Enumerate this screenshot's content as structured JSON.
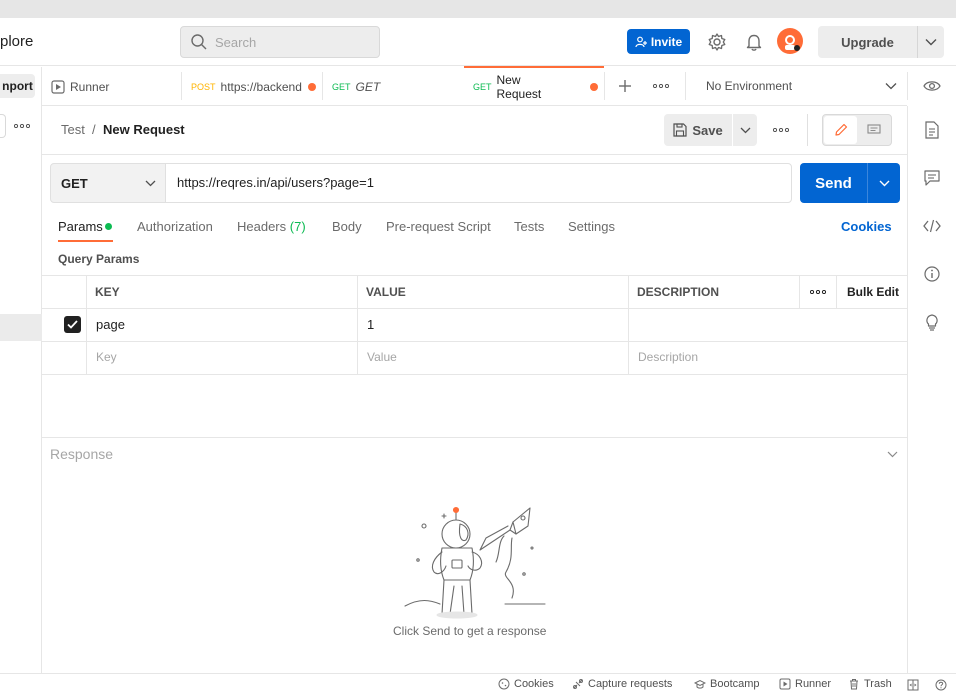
{
  "header": {
    "explore_label": "plore",
    "search_placeholder": "Search",
    "invite_label": "Invite",
    "upgrade_label": "Upgrade"
  },
  "sidebar": {
    "import_label": "nport"
  },
  "tabs": [
    {
      "label": "Runner"
    },
    {
      "method": "POST",
      "label": "https://backend"
    },
    {
      "method": "GET",
      "label": "GET"
    },
    {
      "method": "GET",
      "label": "New Request",
      "active": true
    },
    {
      "label": "No Environment"
    }
  ],
  "breadcrumb": {
    "collection": "Test",
    "separator": "/",
    "request": "New Request"
  },
  "toolbar": {
    "save_label": "Save"
  },
  "request": {
    "method": "GET",
    "url": "https://reqres.in/api/users?page=1",
    "send_label": "Send"
  },
  "request_tabs": {
    "params": "Params",
    "authorization": "Authorization",
    "headers": "Headers",
    "headers_count": "(7)",
    "body": "Body",
    "prerequest": "Pre-request Script",
    "tests": "Tests",
    "settings": "Settings",
    "cookies": "Cookies"
  },
  "query_params": {
    "title": "Query Params",
    "columns": [
      "KEY",
      "VALUE",
      "DESCRIPTION"
    ],
    "bulk_edit": "Bulk Edit",
    "rows": [
      {
        "checked": true,
        "key": "page",
        "value": "1",
        "description": ""
      }
    ],
    "placeholders": {
      "key": "Key",
      "value": "Value",
      "description": "Description"
    }
  },
  "response": {
    "title": "Response",
    "empty_message": "Click Send to get a response"
  },
  "statusbar": {
    "cookies": "Cookies",
    "capture": "Capture requests",
    "bootcamp": "Bootcamp",
    "runner": "Runner",
    "trash": "Trash"
  },
  "colors": {
    "accent": "#ff6c37",
    "primary": "#0265d2",
    "get_method": "#0cbb52",
    "post_method": "#ffb400"
  }
}
